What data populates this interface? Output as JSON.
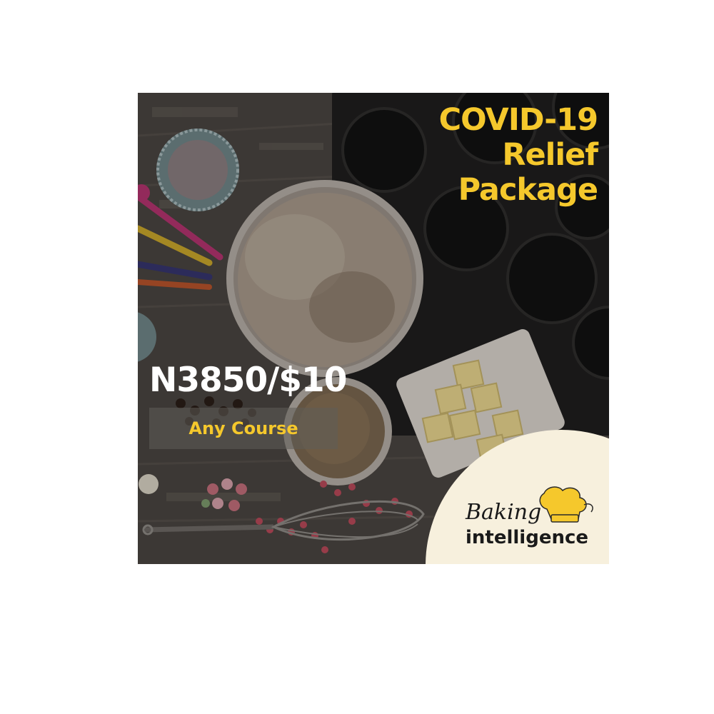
{
  "promo": {
    "headline": [
      "COVID-19",
      "Relief",
      "Package"
    ],
    "price": "N3850/$10",
    "offer": "Any Course"
  },
  "brand": {
    "name_line1": "Baking",
    "name_line2": "intelligence"
  },
  "colors": {
    "accent_yellow": "#f5c82c",
    "badge_cream": "#f7f0dd",
    "scene_overlay": "#3a3532"
  },
  "icons": [
    "chef-hat-icon",
    "whisk-icon"
  ]
}
